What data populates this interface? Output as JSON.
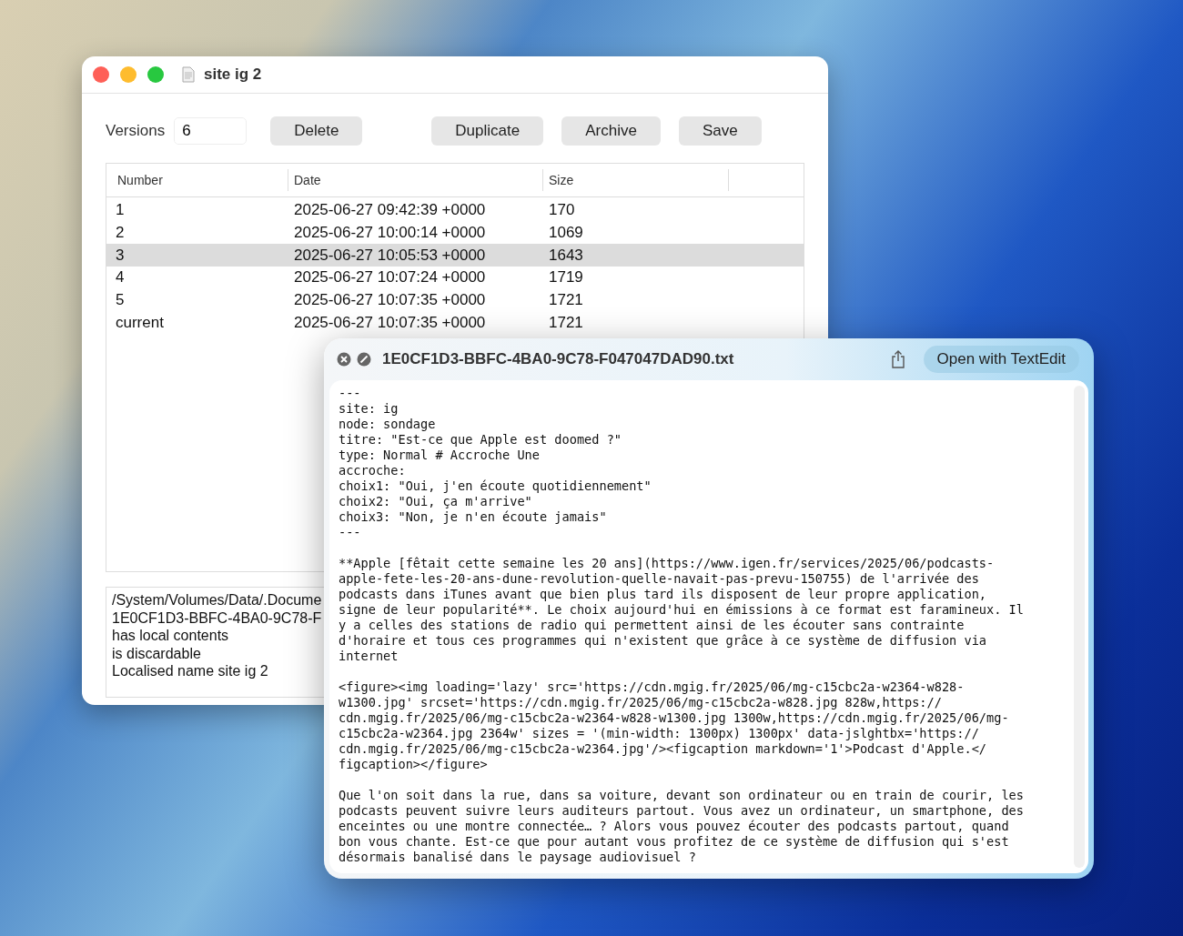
{
  "main_window": {
    "title": "site ig 2",
    "toolbar": {
      "label": "Versions",
      "versions_value": "6",
      "buttons": [
        "Delete",
        "Duplicate",
        "Archive",
        "Save"
      ]
    },
    "table": {
      "columns": [
        "Number",
        "Date",
        "Size"
      ],
      "rows": [
        {
          "number": "1",
          "date": "2025-06-27 09:42:39 +0000",
          "size": "170",
          "selected": false
        },
        {
          "number": "2",
          "date": "2025-06-27 10:00:14 +0000",
          "size": "1069",
          "selected": false
        },
        {
          "number": "3",
          "date": "2025-06-27 10:05:53 +0000",
          "size": "1643",
          "selected": true
        },
        {
          "number": "4",
          "date": "2025-06-27 10:07:24 +0000",
          "size": "1719",
          "selected": false
        },
        {
          "number": "5",
          "date": "2025-06-27 10:07:35 +0000",
          "size": "1721",
          "selected": false
        },
        {
          "number": "current",
          "date": "2025-06-27 10:07:35 +0000",
          "size": "1721",
          "selected": false
        }
      ]
    },
    "info_lines": [
      "/System/Volumes/Data/.Docume",
      "1E0CF1D3-BBFC-4BA0-9C78-F",
      "has local contents",
      "is discardable",
      "Localised name site ig 2"
    ]
  },
  "preview_window": {
    "title": "1E0CF1D3-BBFC-4BA0-9C78-F047047DAD90.txt",
    "open_button": "Open with TextEdit",
    "paragraphs": [
      [
        "---",
        "site: ig",
        "node: sondage",
        "titre: \"Est-ce que Apple est doomed ?\"",
        "type: Normal # Accroche Une",
        "accroche:",
        "choix1: \"Oui, j'en écoute quotidiennement\"",
        "choix2: \"Oui, ça m'arrive\"",
        "choix3: \"Non, je n'en écoute jamais\"",
        "---"
      ],
      [
        "**Apple [fêtait cette semaine les 20 ans](https://www.igen.fr/services/2025/06/podcasts-",
        "apple-fete-les-20-ans-dune-revolution-quelle-navait-pas-prevu-150755) de l'arrivée des",
        "podcasts dans iTunes avant que bien plus tard ils disposent de leur propre application,",
        "signe de leur popularité**. Le choix aujourd'hui en émissions à ce format est faramineux. Il",
        "y a celles des stations de radio qui permettent ainsi de les écouter sans contrainte",
        "d'horaire et tous ces programmes qui n'existent que grâce à ce système de diffusion via",
        "internet"
      ],
      [
        "<figure><img loading='lazy' src='https://cdn.mgig.fr/2025/06/mg-c15cbc2a-w2364-w828-",
        "w1300.jpg' srcset='https://cdn.mgig.fr/2025/06/mg-c15cbc2a-w828.jpg 828w,https://",
        "cdn.mgig.fr/2025/06/mg-c15cbc2a-w2364-w828-w1300.jpg 1300w,https://cdn.mgig.fr/2025/06/mg-",
        "c15cbc2a-w2364.jpg 2364w' sizes = '(min-width: 1300px) 1300px' data-jslghtbx='https://",
        "cdn.mgig.fr/2025/06/mg-c15cbc2a-w2364.jpg'/><figcaption markdown='1'>Podcast d'Apple.</",
        "figcaption></figure>"
      ],
      [
        "Que l'on soit dans la rue, dans sa voiture, devant son ordinateur ou en train de courir, les",
        "podcasts peuvent suivre leurs auditeurs partout. Vous avez un ordinateur, un smartphone, des",
        "enceintes ou une montre connectée… ? Alors vous pouvez écouter des podcasts partout, quand",
        "bon vous chante. Est-ce que pour autant vous profitez de ce système de diffusion qui s'est",
        "désormais banalisé dans le paysage audiovisuel ?"
      ]
    ]
  }
}
